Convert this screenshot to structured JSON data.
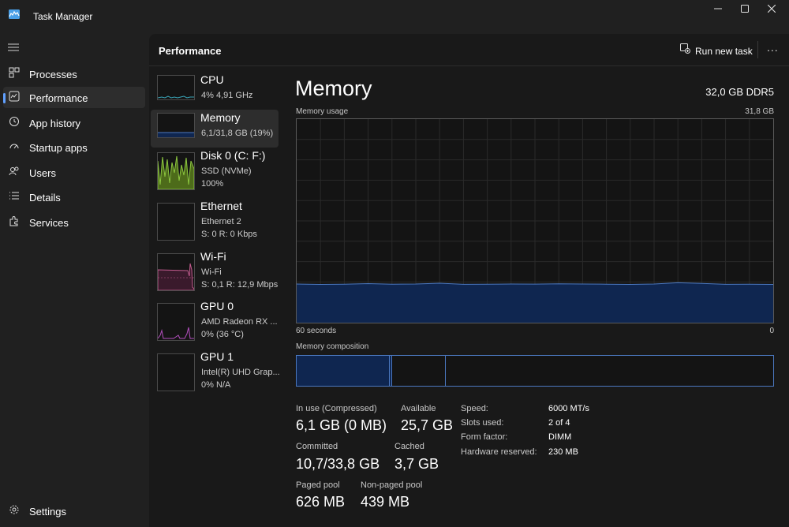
{
  "window": {
    "title": "Task Manager",
    "minimize_icon": "minimize-icon",
    "maximize_icon": "maximize-icon",
    "close_icon": "close-icon"
  },
  "nav": {
    "items": [
      {
        "label": "Processes",
        "icon": "processes-icon"
      },
      {
        "label": "Performance",
        "icon": "performance-icon",
        "selected": true
      },
      {
        "label": "App history",
        "icon": "history-icon"
      },
      {
        "label": "Startup apps",
        "icon": "speedometer-icon"
      },
      {
        "label": "Users",
        "icon": "users-icon"
      },
      {
        "label": "Details",
        "icon": "list-icon"
      },
      {
        "label": "Services",
        "icon": "puzzle-icon"
      }
    ],
    "settings": {
      "label": "Settings",
      "icon": "gear-icon"
    }
  },
  "header": {
    "title": "Performance",
    "run_task_label": "Run new task",
    "more_label": "..."
  },
  "resources": [
    {
      "name": "CPU",
      "line1": "4% 4,91 GHz",
      "line2": ""
    },
    {
      "name": "Memory",
      "line1": "6,1/31,8 GB (19%)",
      "line2": "",
      "selected": true
    },
    {
      "name": "Disk 0 (C: F:)",
      "line1": "SSD (NVMe)",
      "line2": "100%"
    },
    {
      "name": "Ethernet",
      "line1": "Ethernet 2",
      "line2": "S: 0  R: 0 Kbps"
    },
    {
      "name": "Wi-Fi",
      "line1": "Wi-Fi",
      "line2": "S: 0,1  R: 12,9 Mbps"
    },
    {
      "name": "GPU 0",
      "line1": "AMD Radeon RX ...",
      "line2": "0% (36 °C)"
    },
    {
      "name": "GPU 1",
      "line1": "Intel(R) UHD Grap...",
      "line2": "0% N/A"
    }
  ],
  "detail": {
    "title": "Memory",
    "spec": "32,0 GB DDR5",
    "usage_label": "Memory usage",
    "usage_max": "31,8 GB",
    "usage_fraction": 0.19,
    "time_label": "60 seconds",
    "time_zero": "0",
    "composition_label": "Memory composition",
    "stats": {
      "in_use_label": "In use (Compressed)",
      "in_use_value": "6,1 GB (0 MB)",
      "available_label": "Available",
      "available_value": "25,7 GB",
      "committed_label": "Committed",
      "committed_value": "10,7/33,8 GB",
      "cached_label": "Cached",
      "cached_value": "3,7 GB",
      "paged_label": "Paged pool",
      "paged_value": "626 MB",
      "nonpaged_label": "Non-paged pool",
      "nonpaged_value": "439 MB"
    },
    "specs": [
      {
        "label": "Speed:",
        "value": "6000 MT/s"
      },
      {
        "label": "Slots used:",
        "value": "2 of 4"
      },
      {
        "label": "Form factor:",
        "value": "DIMM"
      },
      {
        "label": "Hardware reserved:",
        "value": "230 MB"
      }
    ]
  },
  "colors": {
    "accent": "#60a0ff",
    "memory_fill": "#0f2650",
    "memory_line": "#4b78c0",
    "disk": "#8cc63f",
    "network": "#c25b8e",
    "gpu": "#b44fbf",
    "cpu": "#3aa6b9"
  }
}
